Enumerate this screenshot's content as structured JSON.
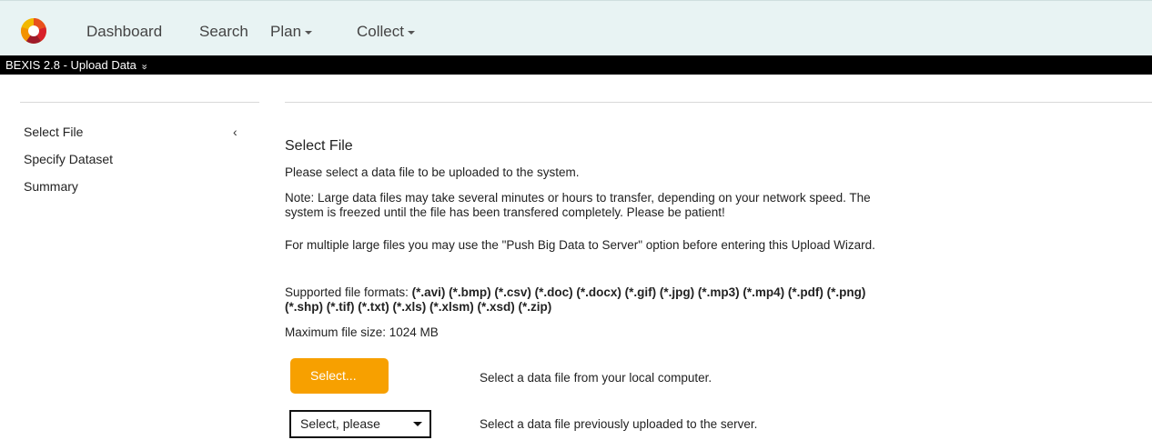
{
  "nav": {
    "items": [
      {
        "label": "Dashboard"
      },
      {
        "label": "Search"
      },
      {
        "label": "Plan"
      },
      {
        "label": "Collect"
      }
    ]
  },
  "titlebar": {
    "title": "BEXIS 2.8 - Upload Data",
    "chevron": "»"
  },
  "sidebar": {
    "items": [
      {
        "label": "Select File"
      },
      {
        "label": "Specify Dataset"
      },
      {
        "label": "Summary"
      }
    ],
    "collapse_glyph": "‹"
  },
  "main": {
    "heading": "Select File",
    "intro": "Please select a data file to be uploaded to the system.",
    "note": "Note: Large data files may take several minutes or hours to transfer, depending on your network speed. The system is freezed until the file has been transfered completely. Please be patient!",
    "multi_note": "For multiple large files you may use the \"Push Big Data to Server\" option before entering this Upload Wizard.",
    "formats_label": "Supported file formats: ",
    "formats": "(*.avi) (*.bmp) (*.csv) (*.doc) (*.docx) (*.gif) (*.jpg) (*.mp3) (*.mp4) (*.pdf) (*.png) (*.shp) (*.tif) (*.txt) (*.xls) (*.xlsm) (*.xsd) (*.zip)",
    "max_size": "Maximum file size: 1024 MB",
    "select_button": "Select...",
    "select_desc": "Select a data file from your local computer.",
    "dropdown_value": "Select, please",
    "dropdown_desc": "Select a data file previously uploaded to the server."
  },
  "colors": {
    "nav_bg": "#e8f3f3",
    "titlebar_bg": "#000000",
    "accent": "#f7a000"
  },
  "icons": {
    "logo": "bexis-logo",
    "nav_caret": "caret-down-icon",
    "titlebar_chevron": "double-chevron-down-icon",
    "sidebar_collapse": "chevron-left-icon",
    "dropdown_caret": "caret-down-icon"
  }
}
